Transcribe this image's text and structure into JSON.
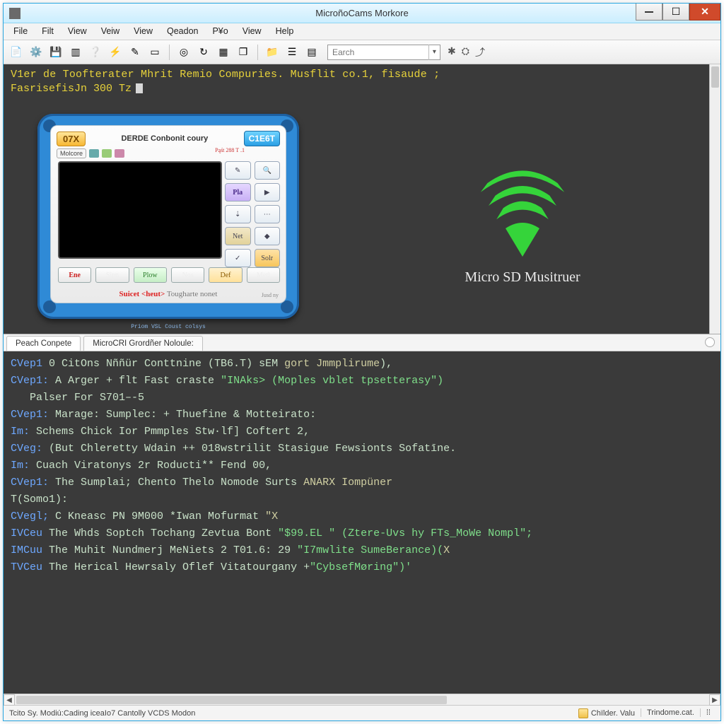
{
  "window": {
    "title": "MicroñoCams Morkore"
  },
  "menu": {
    "items": [
      "File",
      "Filt",
      "View",
      "Veiw",
      "View",
      "Qeadon",
      "P¥o",
      "View",
      "Help"
    ]
  },
  "toolbar": {
    "search_placeholder": "Earch"
  },
  "banner": {
    "line1": "V1er de Toofterater Mhrit Remio Compuries. Musflit co.1, fisaude ;",
    "line2": "FasrisefisJn 300 Tz"
  },
  "device": {
    "badge_left": "07X",
    "title": "DERDE Conbonit coury",
    "badge_right": "C1E6T",
    "molcore": "Molcore",
    "subtext": "Pąśt 288 T .1",
    "side_buttons": {
      "b0": "✎",
      "b1": "🔍",
      "b2": "Pla",
      "b3": "▶",
      "b4": "⇣",
      "b5": "⋯",
      "b6": "Net",
      "b7": "◆",
      "b8": "✓",
      "b9": "Solr"
    },
    "bottom_buttons": {
      "ene": "Ene",
      "sipn": "Sipn",
      "plow": "Plow",
      "nos": "Nos",
      "def": "Def",
      "metl": "Metl"
    },
    "tagline_red": "Suicet <heut>",
    "tagline_gray": " Tougharte nonet",
    "jud": "Jusd ny",
    "footnote": "Priom VSL Coust colsys"
  },
  "hero": {
    "label": "Micro SD Musitruer"
  },
  "tabs": {
    "t0": "Peach Conpete",
    "t1": "MicroCRI Grordñer Noloule:"
  },
  "console": {
    "lines": [
      {
        "pre": "CVep1",
        "body": " 0 CitOns Nññür Conttnine (TB6.T) sEM ",
        "suf": "gort Jmmplirume",
        "tail": "),"
      },
      {
        "pre": "CVep1:",
        "body": " A Arger + flt Fast craste ",
        "str": "\"INAks> (Moples vblet tpsetterasy\")"
      },
      {
        "plain": "   Palser For S701–-5"
      },
      {
        "pre": "CVep1:",
        "body": " Marage: Sumplec: + Thuefine & Motteirato:"
      },
      {
        "pre": "Im:",
        "body": " Schems Chick Ior Pmmples Stw·lf] Coftert 2,"
      },
      {
        "pre": "CVeg:",
        "body": " (But Chleretty Wdain ++ 018wstrilit Stasigue Fewsionts Sofatīne."
      },
      {
        "pre": "Im:",
        "body": " Cuach Viratonys 2r Roducti** Fend 00,"
      },
      {
        "pre": "CVep1:",
        "body": " The Sumplai; Chento Thelo Nomode Surts ",
        "suf": "ANARX Iompüner"
      },
      {
        "plain": "T(Somo1):"
      },
      {
        "pre": "CVegl;",
        "body": " C Kneasc PN 9M000 *Iwan Mofurmat ",
        "suf": "\"X"
      },
      {
        "pre": "IVCeu",
        "body": " The Whds Soptch Tochang Zevtua Bont ",
        "str": "\"$99.EL \" (Ztere-Uvs hy FTs_MoWe Nompl\";"
      },
      {
        "pre": "IMCuu",
        "body": " The Muhit Nundmerj MeNiets 2 T01.6: 29 ",
        "str": "\"I7mwlite SumeBerance)(",
        "suf": "X"
      },
      {
        "pre": "TVCeu",
        "body": " The Herical Hewrsaly Oflef Vitatourgany +",
        "str": "\"CybsefMøring\")'"
      }
    ]
  },
  "status": {
    "left": "Tcito Sy. Modiú:Cading iceaIо7 Cantolly VCDS Modon",
    "right1": "Chïlder. Valu",
    "right2": "Trindome.cat."
  }
}
